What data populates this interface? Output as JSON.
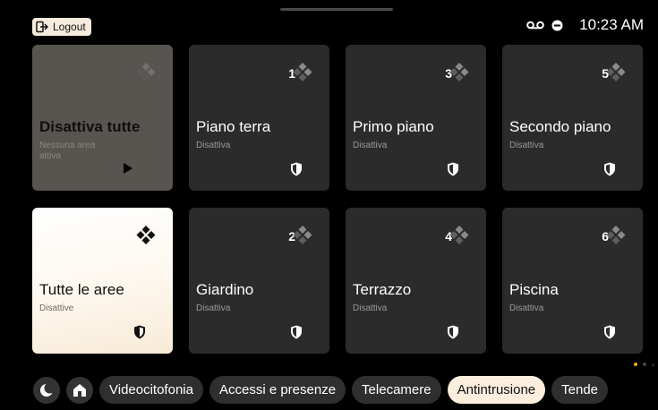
{
  "header": {
    "logout_label": "Logout",
    "time": "10:23 AM",
    "icons": [
      "voicemail-icon",
      "do-not-disturb-icon"
    ]
  },
  "cards": {
    "disable_all": {
      "title": "Disattiva tutte",
      "subtitle": "Nessuna area attiva"
    },
    "all_areas": {
      "title": "Tutte le aree",
      "subtitle": "Disattive"
    },
    "areas": [
      {
        "number": "1",
        "title": "Piano terra",
        "status": "Disattiva"
      },
      {
        "number": "3",
        "title": "Primo piano",
        "status": "Disattiva"
      },
      {
        "number": "5",
        "title": "Secondo piano",
        "status": "Disattiva"
      },
      {
        "number": "2",
        "title": "Giardino",
        "status": "Disattiva"
      },
      {
        "number": "4",
        "title": "Terrazzo",
        "status": "Disattiva"
      },
      {
        "number": "6",
        "title": "Piscina",
        "status": "Disattiva"
      }
    ]
  },
  "pager": {
    "pages": 3,
    "current": 1
  },
  "nav": {
    "icons": [
      "night-mode-icon",
      "home-icon"
    ],
    "items": [
      "Videocitofonia",
      "Accessi e presenze",
      "Telecamere",
      "Antintrusione",
      "Tende"
    ],
    "active": "Antintrusione"
  },
  "colors": {
    "background": "#000000",
    "card": "#2b2b2b",
    "card_disable_all": "#58544f",
    "card_all": "#fdf7ee",
    "accent": "#f6a300",
    "active_pill": "#fbeedd"
  }
}
